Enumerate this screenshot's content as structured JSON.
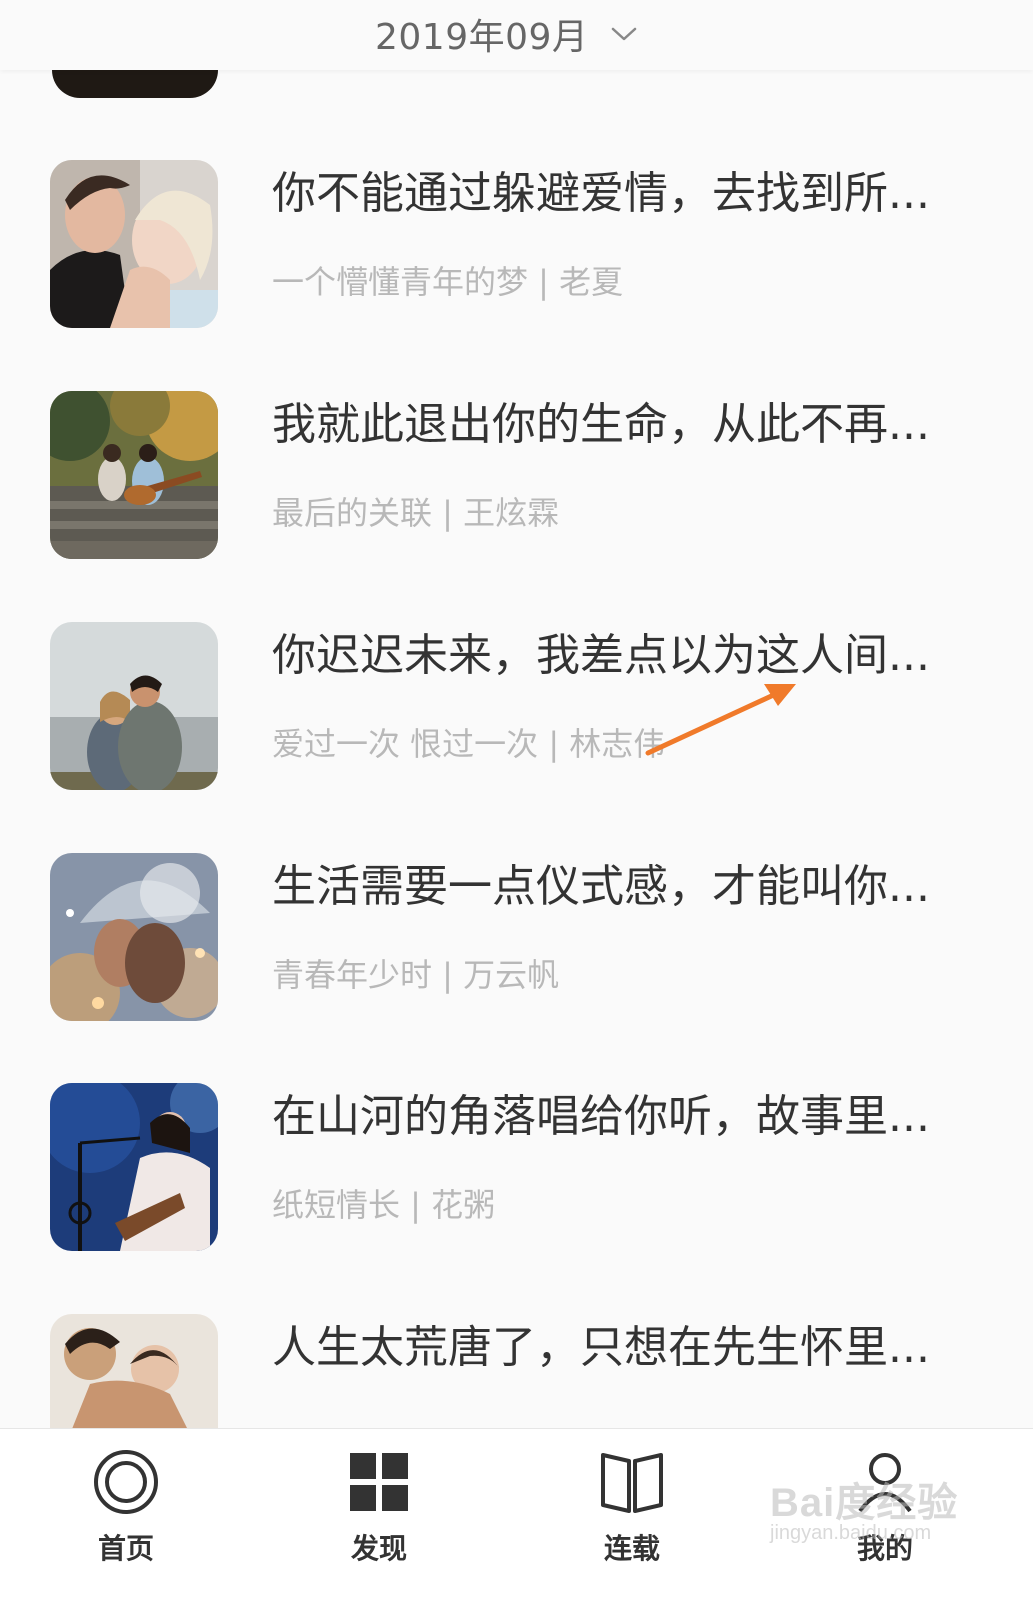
{
  "header": {
    "month": "2019年09月",
    "chevron_icon": "chevron-down-icon"
  },
  "items": [
    {
      "title": "你不能通过躲避爱情，去找到所...",
      "subtitle": "一个懵懂青年的梦 | 老夏",
      "image": "couple-kissing-photo"
    },
    {
      "title": "我就此退出你的生命，从此不再...",
      "subtitle": "最后的关联 | 王炫霖",
      "image": "couple-guitar-park-photo"
    },
    {
      "title": "你迟迟未来，我差点以为这人间...",
      "subtitle": "爱过一次 恨过一次 | 林志伟",
      "image": "couple-lakeside-photo"
    },
    {
      "title": "生活需要一点仪式感，才能叫你...",
      "subtitle": "青春年少时 | 万云帆",
      "image": "couple-umbrella-rain-photo"
    },
    {
      "title": "在山河的角落唱给你听，故事里...",
      "subtitle": "纸短情长 | 花粥",
      "image": "singer-guitar-stage-photo"
    },
    {
      "title": "人生太荒唐了，只想在先生怀里...",
      "subtitle": "",
      "image": "couple-embrace-photo"
    }
  ],
  "annotation": {
    "arrow_color": "#f07a2a"
  },
  "tabbar": {
    "tabs": [
      {
        "label": "首页",
        "icon": "home-circle-icon"
      },
      {
        "label": "发现",
        "icon": "grid-icon"
      },
      {
        "label": "连载",
        "icon": "book-icon"
      },
      {
        "label": "我的",
        "icon": "user-icon"
      }
    ]
  },
  "watermark": {
    "logo": "Bai度经验",
    "url": "jingyan.baidu.com"
  }
}
